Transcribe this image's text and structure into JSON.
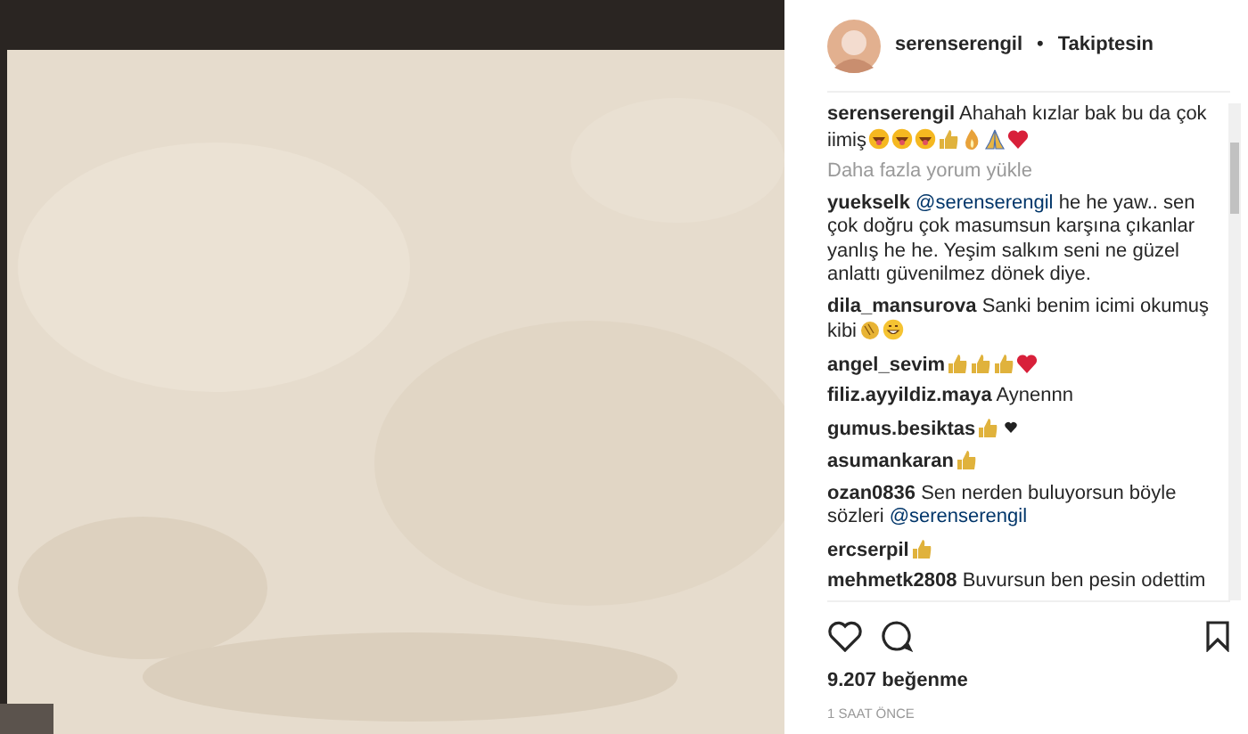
{
  "header": {
    "username": "serenserengil",
    "separator": "•",
    "follow_status": "Takiptesin"
  },
  "comments": [
    {
      "user": "serenserengil",
      "text": "Ahahah kızlar bak bu da çok iimiş",
      "emojis": [
        {
          "kind": "laugh"
        },
        {
          "kind": "laugh"
        },
        {
          "kind": "laugh"
        },
        {
          "kind": "thumb"
        },
        {
          "kind": "flame"
        },
        {
          "kind": "pray"
        },
        {
          "kind": "heart"
        }
      ]
    },
    {
      "kind": "load-more",
      "text": "Daha fazla yorum yükle"
    },
    {
      "user": "yuekselk",
      "mention": "@serenserengil",
      "text": "he he yaw.. sen çok doğru çok masumsun karşına çıkanlar yanlış he he. Yeşim salkım seni ne güzel anlattı güvenilmez dönek diye."
    },
    {
      "user": "dila_mansurova",
      "text": "Sanki benim icimi okumuş kibi",
      "emojis": [
        {
          "kind": "clap"
        },
        {
          "kind": "grin"
        }
      ]
    },
    {
      "user": "angel_sevim",
      "emojis": [
        {
          "kind": "thumb"
        },
        {
          "kind": "thumb"
        },
        {
          "kind": "thumb"
        },
        {
          "kind": "heart"
        }
      ]
    },
    {
      "user": "filiz.ayyildiz.maya",
      "text": "Aynennn"
    },
    {
      "user": "gumus.besiktas",
      "emojis": [
        {
          "kind": "thumb"
        },
        {
          "kind": "small-heart"
        }
      ]
    },
    {
      "user": "asumankaran",
      "emojis": [
        {
          "kind": "thumb"
        }
      ]
    },
    {
      "user": "ozan0836",
      "text": "Sen nerden buluyorsun böyle sözleri",
      "mention_after": "@serenserengil"
    },
    {
      "user": "ercserpil",
      "emojis": [
        {
          "kind": "thumb"
        }
      ]
    },
    {
      "user": "mehmetk2808",
      "text": "Buvursun ben pesin odettim"
    }
  ],
  "likes": "9.207 beğenme",
  "time": "1 SAAT ÖNCE"
}
